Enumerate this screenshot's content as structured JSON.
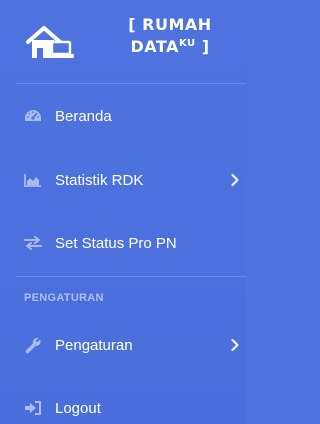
{
  "brand": {
    "line1": "[ RUMAH",
    "line2_main": "DATA",
    "line2_sup": "KU",
    "line2_end": " ]",
    "icon": "house-laptop-icon"
  },
  "nav": {
    "items": [
      {
        "label": "Beranda",
        "icon": "tachometer-icon",
        "has_submenu": false
      },
      {
        "label": "Statistik RDK",
        "icon": "area-chart-icon",
        "has_submenu": true
      },
      {
        "label": "Set Status Pro PN",
        "icon": "exchange-arrows-icon",
        "has_submenu": false
      }
    ],
    "section_heading": "PENGATURAN",
    "settings_items": [
      {
        "label": "Pengaturan",
        "icon": "wrench-icon",
        "has_submenu": true
      },
      {
        "label": "Logout",
        "icon": "sign-out-icon",
        "has_submenu": false
      }
    ]
  },
  "colors": {
    "sidebar_bg": "#4e73df",
    "text": "#ffffff",
    "icon_muted": "#a8bbef"
  }
}
